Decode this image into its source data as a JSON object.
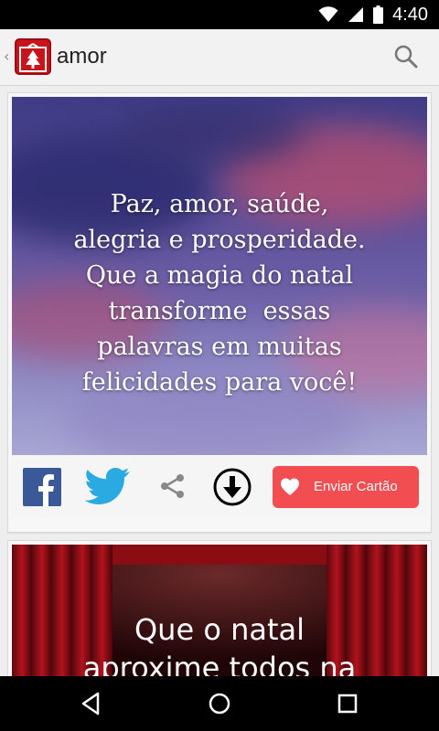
{
  "status_bar": {
    "time": "4:40"
  },
  "action_bar": {
    "title": "amor"
  },
  "cards": [
    {
      "text_lines": [
        "Paz, amor, saúde,",
        "alegria e prosperidade.",
        "Que a magia do natal",
        "transforme  essas",
        "palavras em muitas",
        "felicidades para você!"
      ],
      "send_label": "Enviar Cartão"
    },
    {
      "text_lines": [
        "Que o natal",
        "aproxime todos na"
      ]
    }
  ],
  "colors": {
    "send_button": "#f24d50",
    "facebook": "#3b5998",
    "twitter": "#2ba9e1",
    "app_icon": "#c8141b"
  },
  "icons": {
    "status": [
      "wifi-icon",
      "signal-icon",
      "battery-icon"
    ],
    "nav": [
      "back-icon",
      "home-icon",
      "recents-icon"
    ]
  }
}
